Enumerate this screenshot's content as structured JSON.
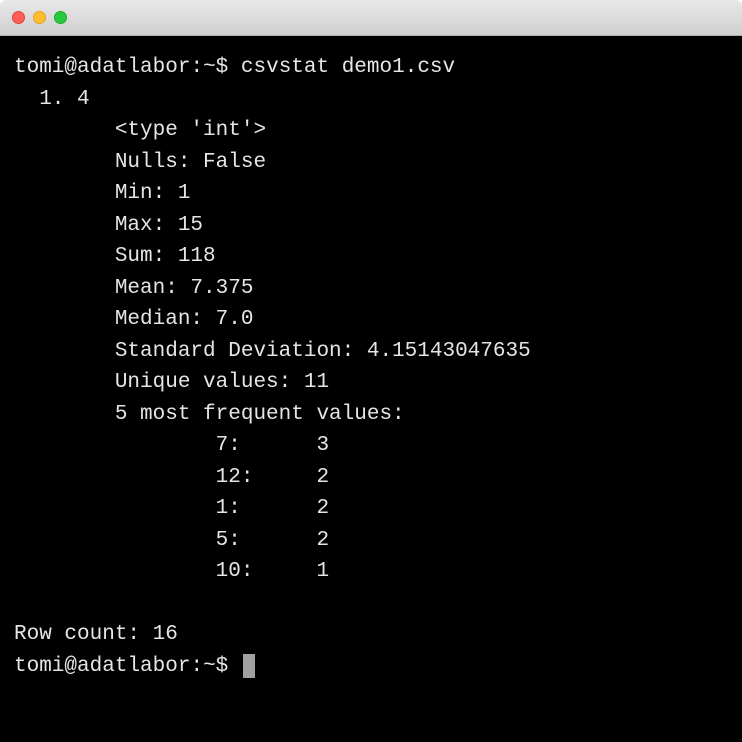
{
  "prompt": {
    "user": "tomi",
    "host": "adatlabor",
    "path": "~",
    "symbol": "$"
  },
  "command": "csvstat demo1.csv",
  "output": {
    "column_header": "  1. 4",
    "type_line": "        <type 'int'>",
    "nulls": "        Nulls: False",
    "min": "        Min: 1",
    "max": "        Max: 15",
    "sum": "        Sum: 118",
    "mean": "        Mean: 7.375",
    "median": "        Median: 7.0",
    "stddev": "        Standard Deviation: 4.15143047635",
    "unique": "        Unique values: 11",
    "freq_header": "        5 most frequent values:",
    "freq1": "                7:      3",
    "freq2": "                12:     2",
    "freq3": "                1:      2",
    "freq4": "                5:      2",
    "freq5": "                10:     1",
    "rowcount": "Row count: 16"
  }
}
